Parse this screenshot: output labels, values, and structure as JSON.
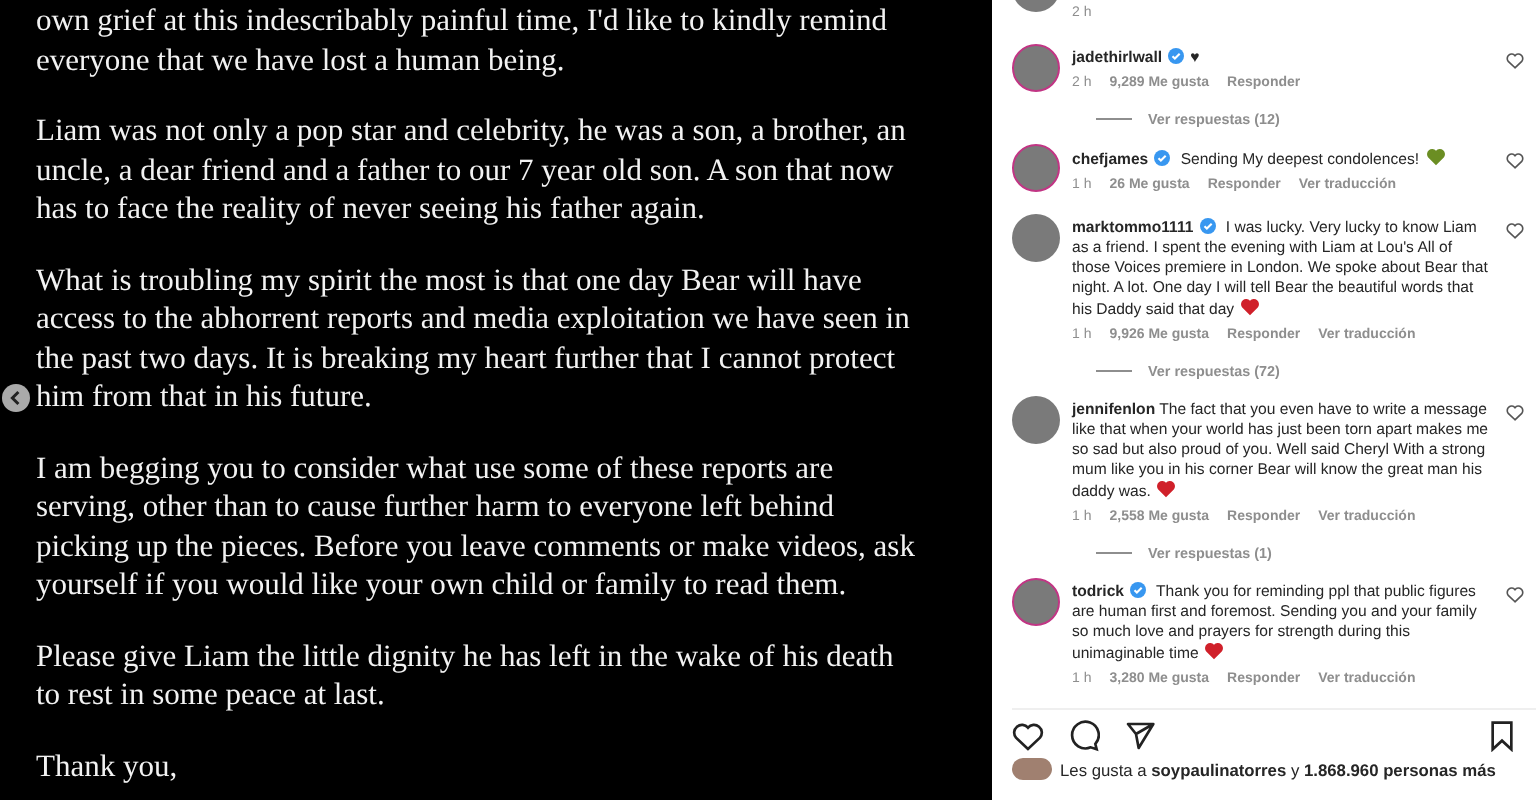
{
  "post": {
    "paragraphs": [
      "own grief at this indescribably painful time, I'd like to kindly remind everyone that we have lost a human being.",
      "Liam was not only a pop star and celebrity, he was a son, a brother, an uncle, a dear friend and a father to our 7 year old son. A son that now has to face the reality of never seeing his father again.",
      "What is troubling my spirit the most is that one day Bear will have access to the abhorrent reports and media exploitation we have seen in the past two days. It is breaking my heart further that I cannot protect him from that in his future.",
      "I am begging you to consider what use some of these reports are serving, other than to cause further harm to everyone left behind picking up the pieces. Before you leave comments or make videos, ask yourself if you would like your own child or family to read them.",
      "Please give Liam the little dignity he has left in the wake of his death to rest in some peace at last.",
      "Thank you,"
    ]
  },
  "comments": [
    {
      "kind": "partial",
      "time": "2 h"
    },
    {
      "kind": "full",
      "username": "jadethirlwall",
      "verified": true,
      "suffix": "♥",
      "time": "2 h",
      "likes": "9,289 Me gusta",
      "reply": "Responder",
      "replies_label": "Ver respuestas (12)"
    },
    {
      "kind": "full",
      "username": "chefjames",
      "verified": true,
      "text": "Sending My deepest condolences!",
      "color": "#6b8e23",
      "time": "1 h",
      "likes": "26 Me gusta",
      "reply": "Responder",
      "translate": "Ver traducción"
    },
    {
      "kind": "full",
      "username": "marktommo1111",
      "verified": true,
      "text": "I was lucky. Very lucky to know Liam as a friend. I spent the evening with Liam at Lou's All of those Voices premiere in London. We spoke about Bear that night. A lot. One day I will tell Bear the beautiful words that his Daddy said that day",
      "color": "#d0202a",
      "time": "1 h",
      "likes": "9,926 Me gusta",
      "reply": "Responder",
      "translate": "Ver traducción",
      "replies_label": "Ver respuestas (72)"
    },
    {
      "kind": "full",
      "username": "jennifenlon",
      "verified": false,
      "text": "The fact that you even have to write a message like that when your world has just been torn apart makes me so sad but also proud of you. Well said Cheryl With a strong mum like you in his corner Bear will know the great man his daddy was.",
      "color": "#d0202a",
      "time": "1 h",
      "likes": "2,558 Me gusta",
      "reply": "Responder",
      "translate": "Ver traducción",
      "replies_label": "Ver respuestas (1)"
    },
    {
      "kind": "full",
      "username": "todrick",
      "verified": true,
      "text": "Thank you for reminding ppl that public figures are human first and foremost. Sending you and your family so much love and prayers for strength during this unimaginable time",
      "color": "#d0202a",
      "time": "1 h",
      "likes": "3,280 Me gusta",
      "reply": "Responder",
      "translate": "Ver traducción"
    }
  ],
  "likes_line": "Les gusta a **soypaulinatorres** y **1.868.960 personas más**"
}
